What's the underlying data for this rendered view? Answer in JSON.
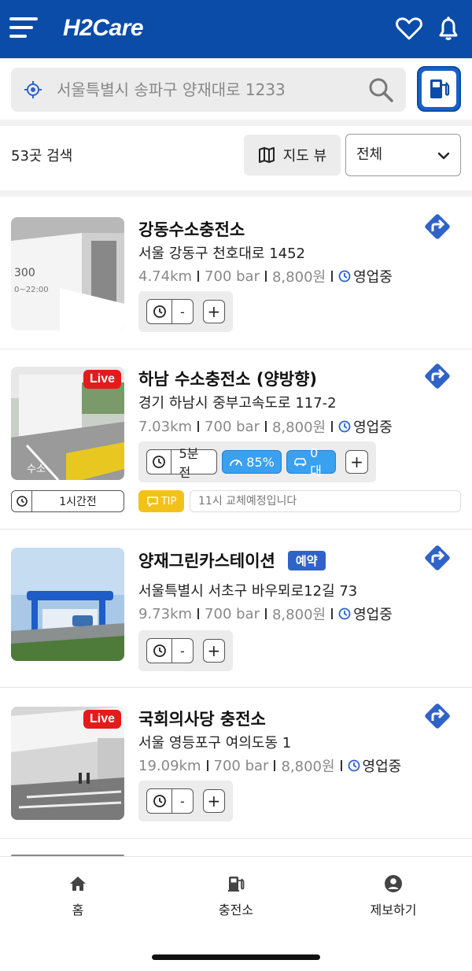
{
  "header": {
    "logo_text": "H2Care"
  },
  "search": {
    "location_text": "서울특별시 송파구 양재대로 1233"
  },
  "filters": {
    "result_count": "53곳 검색",
    "map_view_label": "지도 뷰",
    "select_value": "전체"
  },
  "stations": [
    {
      "name": "강동수소충전소",
      "address": "서울 강동구 천호대로 1452",
      "distance": "4.74km",
      "pressure": "700 bar",
      "price": "8,800원",
      "status": "영업중",
      "wait": "-"
    },
    {
      "name": "하남 수소충전소 (양방향)",
      "address": "경기 하남시 중부고속도로 117-2",
      "distance": "7.03km",
      "pressure": "700 bar",
      "price": "8,800원",
      "status": "영업중",
      "live": "Live",
      "wait": "5분전",
      "gauge": "85%",
      "cars": "0대",
      "wait_time": "1시간전",
      "tip_label": "TIP",
      "notice": "11시 교체예정입니다"
    },
    {
      "name": "양재그린카스테이션",
      "reserve": "예약",
      "address": "서울특별시 서초구 바우뫼로12길 73",
      "distance": "9.73km",
      "pressure": "700 bar",
      "price": "8,800원",
      "status": "영업중",
      "wait": "-"
    },
    {
      "name": "국회의사당 충전소",
      "address": "서울 영등포구 여의도동 1",
      "distance": "19.09km",
      "pressure": "700 bar",
      "price": "8,800원",
      "status": "영업중",
      "live": "Live",
      "wait": "-"
    }
  ],
  "bottom_nav": {
    "home": "홈",
    "stations": "충전소",
    "report": "제보하기"
  },
  "colors": {
    "brand_blue": "#0a4ca8",
    "live_red": "#e31b1b",
    "chip_blue": "#3aa0f0",
    "tip_yellow": "#f3c21a"
  }
}
